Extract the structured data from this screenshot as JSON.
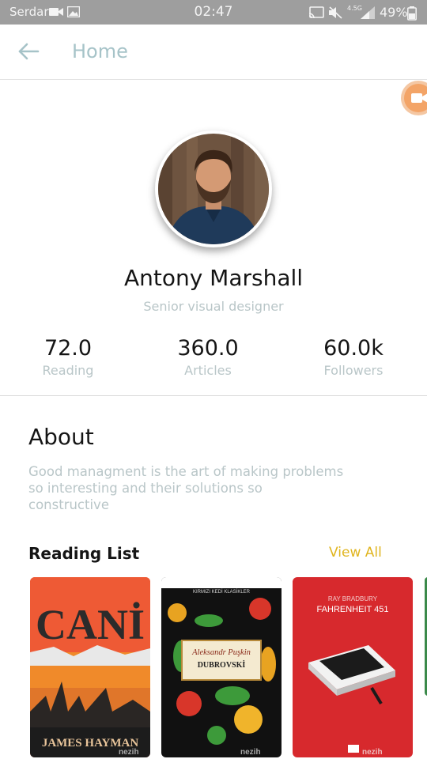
{
  "status_bar": {
    "carrier": "Serdar",
    "time": "02:47",
    "network": "4.5G",
    "battery": "49%"
  },
  "header": {
    "title": "Home"
  },
  "profile": {
    "name": "Antony Marshall",
    "role": "Senior visual designer"
  },
  "stats": [
    {
      "value": "72.0",
      "label": "Reading"
    },
    {
      "value": "360.0",
      "label": "Articles"
    },
    {
      "value": "60.0k",
      "label": "Followers"
    }
  ],
  "about": {
    "title": "About",
    "text": "Good managment is the art of making problems so interesting and their solutions so constructive"
  },
  "reading_list": {
    "title": "Reading List",
    "view_all": "View All",
    "books": [
      {
        "title": "CANİ",
        "author": "JAMES HAYMAN",
        "watermark": "nezih"
      },
      {
        "title": "DUBROVSKİ",
        "author": "Aleksandr Puşkin",
        "series": "KIRMIZI KEDİ KLASİKLER",
        "watermark": "nezih"
      },
      {
        "title": "FAHRENHEIT 451",
        "author": "RAY BRADBURY",
        "watermark": "nezih"
      }
    ]
  },
  "colors": {
    "status_bar": "#9e9e9e",
    "title_muted": "#a6c3c8",
    "subtle_text": "#b9c6c8",
    "accent": "#e0b51f",
    "fab": "#f3a467"
  }
}
